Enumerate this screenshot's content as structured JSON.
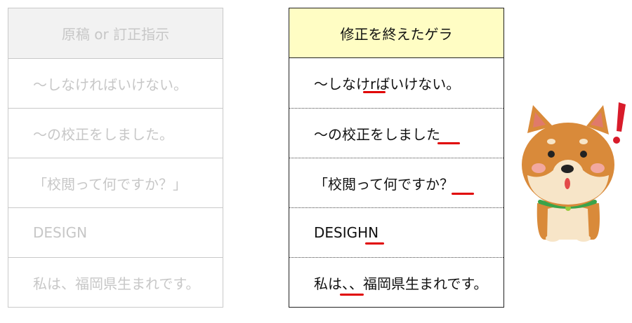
{
  "left_table": {
    "header": "原稿 or 訂正指示",
    "rows": [
      "～しなければいけない。",
      "～の校正をしました。",
      "「校閲って何ですか？」",
      "DESIGN",
      "私は、福岡県生まれです。"
    ]
  },
  "right_table": {
    "header": "修正を終えたゲラ",
    "rows": [
      "～しなけrばいけない。",
      "～の校正をしました",
      "「校閲って何ですか？",
      "DESIGHN",
      "私は、、福岡県生まれです。"
    ]
  },
  "colors": {
    "header_left_bg": "#f2f2f2",
    "header_right_bg": "#fffdc4",
    "mark": "#e00000",
    "exclamation": "#d81b2a"
  }
}
